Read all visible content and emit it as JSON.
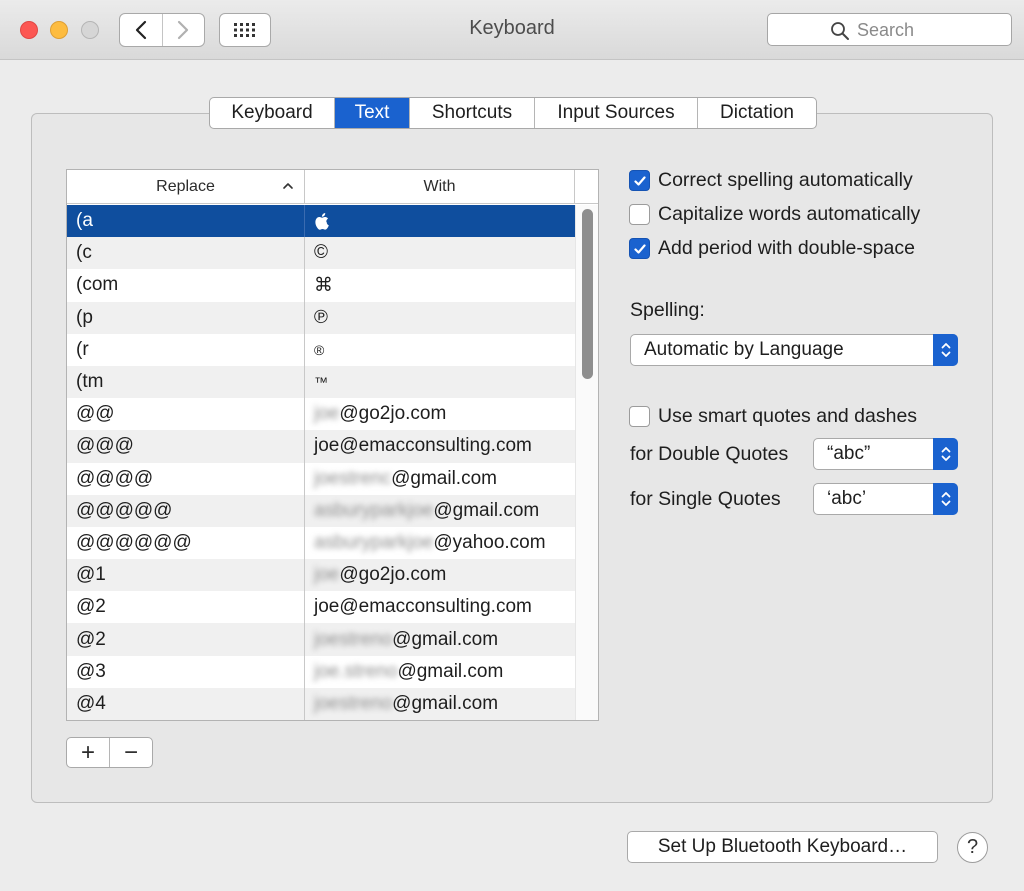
{
  "window": {
    "title": "Keyboard",
    "search_placeholder": "Search"
  },
  "tabs": [
    {
      "label": "Keyboard",
      "active": false
    },
    {
      "label": "Text",
      "active": true
    },
    {
      "label": "Shortcuts",
      "active": false
    },
    {
      "label": "Input Sources",
      "active": false
    },
    {
      "label": "Dictation",
      "active": false
    }
  ],
  "table": {
    "columns": {
      "replace": "Replace",
      "with": "With"
    },
    "rows": [
      {
        "replace": "(a",
        "with": "",
        "with_icon": "apple-logo-icon",
        "selected": true
      },
      {
        "replace": "(c",
        "with": "©"
      },
      {
        "replace": "(com",
        "with": "⌘"
      },
      {
        "replace": "(p",
        "with": "℗"
      },
      {
        "replace": "(r",
        "with": "®"
      },
      {
        "replace": "(tm",
        "with": "™"
      },
      {
        "replace": "@@",
        "with_redacted": "joe",
        "with": "@go2jo.com"
      },
      {
        "replace": "@@@",
        "with": "joe@emacconsulting.com"
      },
      {
        "replace": "@@@@",
        "with_redacted": "joestrenc",
        "with": "@gmail.com"
      },
      {
        "replace": "@@@@@",
        "with_redacted": "asburyparkjoe",
        "with": "@gmail.com"
      },
      {
        "replace": "@@@@@@",
        "with_redacted": "asburyparkjoe",
        "with": "@yahoo.com"
      },
      {
        "replace": "@1",
        "with_redacted": "joe",
        "with": "@go2jo.com"
      },
      {
        "replace": "@2",
        "with": "joe@emacconsulting.com"
      },
      {
        "replace": "@2",
        "with_redacted": "joestreno",
        "with": "@gmail.com"
      },
      {
        "replace": "@3",
        "with_redacted": "joe.streno",
        "with": "@gmail.com"
      },
      {
        "replace": "@4",
        "with_redacted": "joestreno",
        "with": "@gmail.com"
      }
    ]
  },
  "buttons": {
    "add": "+",
    "remove": "−",
    "bluetooth": "Set Up Bluetooth Keyboard…",
    "help": "?"
  },
  "options": {
    "correct_spelling": {
      "label": "Correct spelling automatically",
      "checked": true
    },
    "capitalize_words": {
      "label": "Capitalize words automatically",
      "checked": false
    },
    "add_period": {
      "label": "Add period with double-space",
      "checked": true
    },
    "spelling_label": "Spelling:",
    "spelling_value": "Automatic by Language",
    "smart_quotes": {
      "label": "Use smart quotes and dashes",
      "checked": false
    },
    "double_quotes_label": "for Double Quotes",
    "double_quotes_value": "“abc”",
    "single_quotes_label": "for Single Quotes",
    "single_quotes_value": "‘abc’"
  },
  "colors": {
    "accent": "#1a62cf",
    "selected_row": "#0f4e9e"
  }
}
